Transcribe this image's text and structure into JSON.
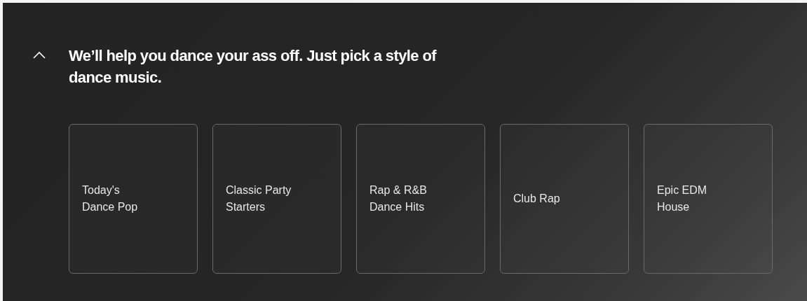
{
  "section": {
    "expanded": true,
    "title": "We’ll help you dance your ass off. Just pick a style of dance music."
  },
  "cards": [
    {
      "label": "Today's\nDance Pop"
    },
    {
      "label": "Classic Party\nStarters"
    },
    {
      "label": "Rap & R&B\nDance Hits"
    },
    {
      "label": "Club Rap"
    },
    {
      "label": "Epic EDM\nHouse"
    }
  ]
}
